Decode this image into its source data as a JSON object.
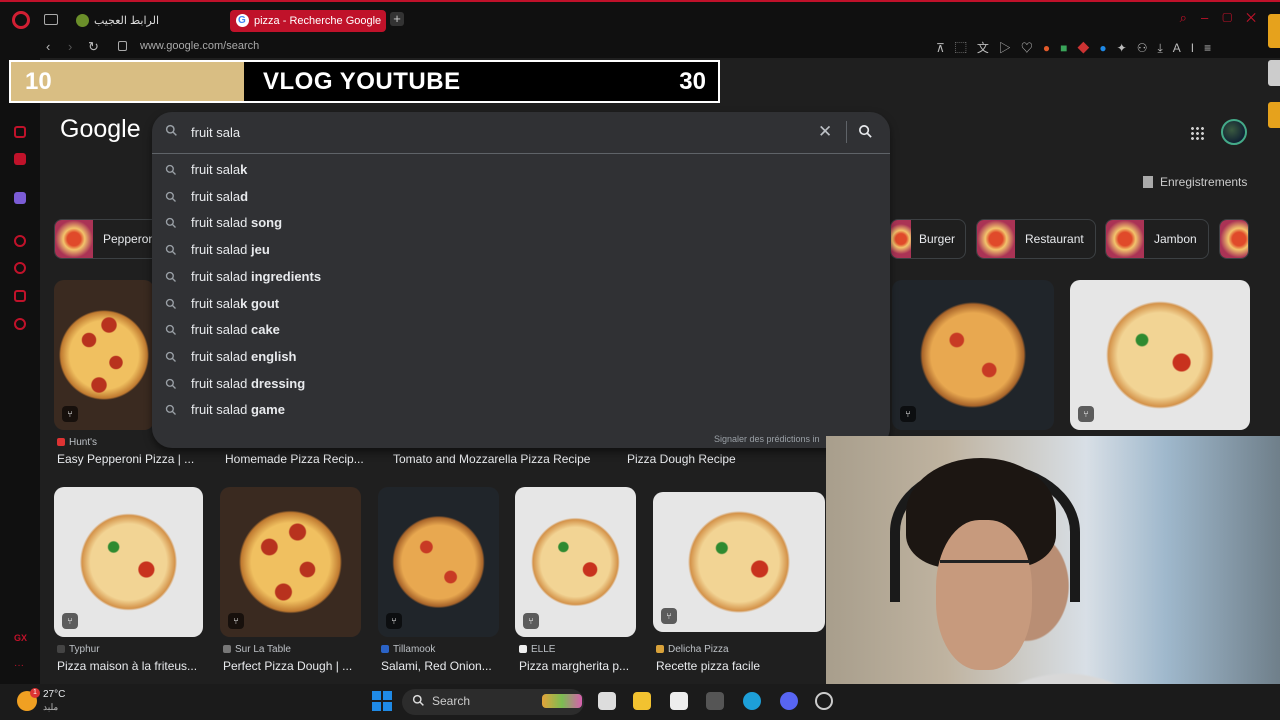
{
  "browser": {
    "tabs": [
      {
        "label": "الرابط العجيب",
        "active": false
      },
      {
        "label": "pizza - Recherche Google",
        "active": true
      }
    ],
    "url": "www.google.com/search"
  },
  "overlay": {
    "left_value": "10",
    "title": "VLOG YOUTUBE",
    "right_value": "30",
    "progress_fraction": 0.33
  },
  "google": {
    "logo": "Google",
    "saved_label": "Enregistrements"
  },
  "search": {
    "query": "fruit sala",
    "suggestions": [
      {
        "typed": "fruit sala",
        "completion": "k"
      },
      {
        "typed": "fruit sala",
        "completion": "d"
      },
      {
        "typed": "fruit salad",
        "completion": " song"
      },
      {
        "typed": "fruit salad",
        "completion": " jeu"
      },
      {
        "typed": "fruit salad",
        "completion": " ingredients"
      },
      {
        "typed": "fruit sala",
        "completion": "k gout"
      },
      {
        "typed": "fruit salad",
        "completion": " cake"
      },
      {
        "typed": "fruit salad",
        "completion": " english"
      },
      {
        "typed": "fruit salad",
        "completion": " dressing"
      },
      {
        "typed": "fruit salad",
        "completion": " game"
      }
    ],
    "report_label": "Signaler des prédictions in"
  },
  "chips": [
    {
      "label": "Pepperoni"
    },
    {
      "label": "Burger"
    },
    {
      "label": "Restaurant"
    },
    {
      "label": "Jambon"
    }
  ],
  "row1": [
    {
      "source": "Hunt's",
      "title": "Easy Pepperoni Pizza | ..."
    },
    {
      "source": "",
      "title": "Homemade Pizza Recip..."
    },
    {
      "source": "",
      "title": "Tomato and Mozzarella Pizza Recipe"
    },
    {
      "source": "",
      "title": "Pizza Dough Recipe"
    }
  ],
  "row2": [
    {
      "source": "Typhur",
      "title": "Pizza maison à la friteus..."
    },
    {
      "source": "Sur La Table",
      "title": "Perfect Pizza Dough | ..."
    },
    {
      "source": "Tillamook",
      "title": "Salami, Red Onion..."
    },
    {
      "source": "ELLE",
      "title": "Pizza margherita p..."
    },
    {
      "source": "Delicha Pizza",
      "title": "Recette pizza facile"
    }
  ],
  "taskbar": {
    "weather_temp": "27°C",
    "weather_desc": "ملبد",
    "weather_badge": "1",
    "search_label": "Search"
  }
}
